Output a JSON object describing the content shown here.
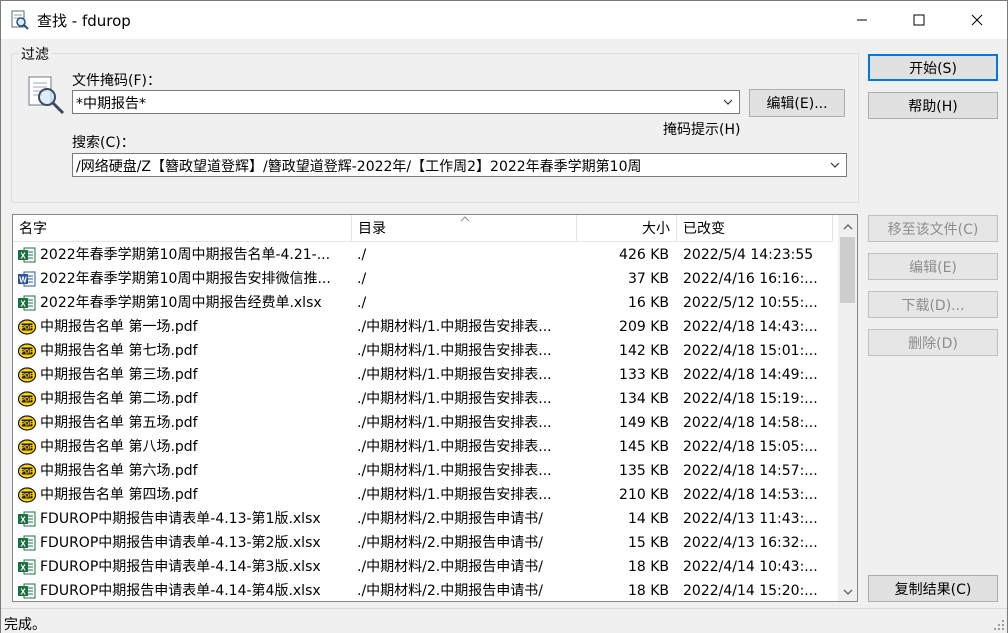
{
  "window": {
    "title": "查找 - fdurop",
    "minimize_icon": "minimize-icon",
    "maximize_icon": "maximize-icon",
    "close_icon": "close-icon"
  },
  "filter": {
    "legend": "过滤",
    "mask_label": "文件掩码(F)：",
    "mask_value": "*中期报告*",
    "edit_button": "编辑(E)...",
    "mask_hint": "掩码提示(H)",
    "search_label": "搜索(C)：",
    "search_value": "/网络硬盘/Z【簪政望道登辉】/簪政望道登辉-2022年/【工作周2】2022年春季学期第10周"
  },
  "buttons": {
    "start": "开始(S)",
    "help": "帮助(H)",
    "goto_file": "移至该文件(C)",
    "edit": "编辑(E)",
    "download": "下载(D)...",
    "delete": "删除(D)",
    "copy_results": "复制结果(C)"
  },
  "list": {
    "columns": {
      "name": "名字",
      "dir": "目录",
      "size": "大小",
      "modified": "已改变"
    },
    "rows": [
      {
        "type": "xlsx",
        "name": "2022年春季学期第10周中期报告名单-4.21-...",
        "dir": "./",
        "size": "426 KB",
        "modified": "2022/5/4 14:23:55"
      },
      {
        "type": "docx",
        "name": "2022年春季学期第10周中期报告安排微信推...",
        "dir": "./",
        "size": "37 KB",
        "modified": "2022/4/16 16:16:..."
      },
      {
        "type": "xlsx",
        "name": "2022年春季学期第10周中期报告经费单.xlsx",
        "dir": "./",
        "size": "16 KB",
        "modified": "2022/5/12 10:55:..."
      },
      {
        "type": "pdf",
        "name": "中期报告名单 第一场.pdf",
        "dir": "./中期材料/1.中期报告安排表...",
        "size": "209 KB",
        "modified": "2022/4/18 14:43:..."
      },
      {
        "type": "pdf",
        "name": "中期报告名单 第七场.pdf",
        "dir": "./中期材料/1.中期报告安排表...",
        "size": "142 KB",
        "modified": "2022/4/18 15:01:..."
      },
      {
        "type": "pdf",
        "name": "中期报告名单 第三场.pdf",
        "dir": "./中期材料/1.中期报告安排表...",
        "size": "133 KB",
        "modified": "2022/4/18 14:49:..."
      },
      {
        "type": "pdf",
        "name": "中期报告名单 第二场.pdf",
        "dir": "./中期材料/1.中期报告安排表...",
        "size": "134 KB",
        "modified": "2022/4/18 15:19:..."
      },
      {
        "type": "pdf",
        "name": "中期报告名单 第五场.pdf",
        "dir": "./中期材料/1.中期报告安排表...",
        "size": "149 KB",
        "modified": "2022/4/18 14:58:..."
      },
      {
        "type": "pdf",
        "name": "中期报告名单 第八场.pdf",
        "dir": "./中期材料/1.中期报告安排表...",
        "size": "145 KB",
        "modified": "2022/4/18 15:05:..."
      },
      {
        "type": "pdf",
        "name": "中期报告名单 第六场.pdf",
        "dir": "./中期材料/1.中期报告安排表...",
        "size": "135 KB",
        "modified": "2022/4/18 14:57:..."
      },
      {
        "type": "pdf",
        "name": "中期报告名单 第四场.pdf",
        "dir": "./中期材料/1.中期报告安排表...",
        "size": "210 KB",
        "modified": "2022/4/18 14:53:..."
      },
      {
        "type": "xlsx",
        "name": "FDUROP中期报告申请表单-4.13-第1版.xlsx",
        "dir": "./中期材料/2.中期报告申请书/",
        "size": "14 KB",
        "modified": "2022/4/13 11:43:..."
      },
      {
        "type": "xlsx",
        "name": "FDUROP中期报告申请表单-4.13-第2版.xlsx",
        "dir": "./中期材料/2.中期报告申请书/",
        "size": "15 KB",
        "modified": "2022/4/13 16:32:..."
      },
      {
        "type": "xlsx",
        "name": "FDUROP中期报告申请表单-4.14-第3版.xlsx",
        "dir": "./中期材料/2.中期报告申请书/",
        "size": "18 KB",
        "modified": "2022/4/14 10:43:..."
      },
      {
        "type": "xlsx",
        "name": "FDUROP中期报告申请表单-4.14-第4版.xlsx",
        "dir": "./中期材料/2.中期报告申请书/",
        "size": "18 KB",
        "modified": "2022/4/14 15:20:..."
      }
    ]
  },
  "status": {
    "text": "完成。"
  },
  "colors": {
    "excel": "#1d6f42",
    "word": "#2b579a",
    "pdf_yellow": "#ffd400",
    "accent": "#0078d7"
  }
}
